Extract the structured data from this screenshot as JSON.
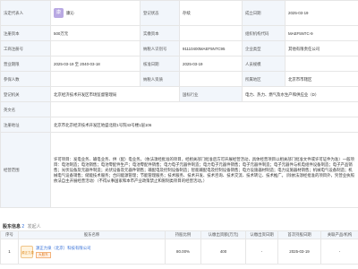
{
  "info": {
    "legal_rep_label": "法定代表人",
    "legal_rep_avatar": "康",
    "legal_rep_name": "康沁",
    "reg_status_label": "登记状态",
    "reg_status": "存续",
    "founded_label": "成立日期",
    "founded": "2025-03-19",
    "reg_capital_label": "注册资本",
    "reg_capital": "500万元",
    "paid_capital_label": "实缴资本",
    "paid_capital": "",
    "org_code_label": "组织机构代码",
    "org_code": "MAEF5NTC-9",
    "biz_reg_no_label": "工商注册号",
    "biz_reg_no": "",
    "taxpayer_no_label": "纳税人识别号",
    "taxpayer_no": "91110400MAEF5NTC95",
    "type_label": "企业类型",
    "type": "其他有限责任公司",
    "term_label": "营业期限",
    "term": "2025-03-19 至 2040-03-18",
    "approval_label": "核准日期",
    "approval": "2025-03-19",
    "staff_label": "人员规模",
    "staff": "",
    "insured_label": "参保人数",
    "insured": "",
    "taxpayer_qual_label": "纳税人资质",
    "taxpayer_qual": "",
    "region_label": "所属地区",
    "region": "北京市市辖区",
    "authority_label": "登记机关",
    "authority": "北京经济技术开发区市场监督管理局",
    "industry_label": "国标行业",
    "industry": "电力、热力、燃气及水生产和供应业（D）",
    "english_label": "英文名",
    "english": "",
    "address_label": "注册地址",
    "address": "北京市北京经济技术开发区地盛北街1号院43号楼1层106",
    "scope_label": "经营范围",
    "scope": "许可项目：发电业务、输电业务、供（配）电业务。（依法须经批准的项目，经相关部门批准后方可开展经营活动，具体经营项目以相关部门批准文件或许可证件为准）一般项目：电池制造；电池销售；电池零配件生产；电池零配件销售；电力电子元器件制造；电力电子元器件销售；电子元器件制造；电子元器件与机电组件设备制造；电子产品销售；光伏设备及元器件制造；光伏设备及元器件销售；输配电及控制设备制造；智能输配电及控制设备销售；电力设施器材制造；电力设施器材销售；机械电气设备制造；机械电气设备销售；储能技术服务；合同能源管理；节能管理服务；技术服务、技术开发、技术咨询、技术交流、技术转让、技术推广。（除依法须经批准的项目外，凭营业执照依法自主开展经营活动）（不得从事国家和本市产业政策禁止和限制类项目的经营活动。）"
  },
  "shareholders": {
    "title": "股东信息",
    "count": "2",
    "subtitle": "发起人",
    "columns": [
      "序号",
      "股东名称",
      "持股比例",
      "认缴出资额(万元)",
      "认缴出资日期",
      "首次持股日期",
      "关联产品/机构"
    ],
    "rows": [
      {
        "index": "1",
        "logo": "源正力泉",
        "name": "源正力泉（北京）科技有限公司",
        "tag": "大股东",
        "ratio": "80.00%",
        "subscribed": "400",
        "sub_date": "-",
        "first_date": "2025-03-19",
        "related": "-"
      }
    ]
  }
}
